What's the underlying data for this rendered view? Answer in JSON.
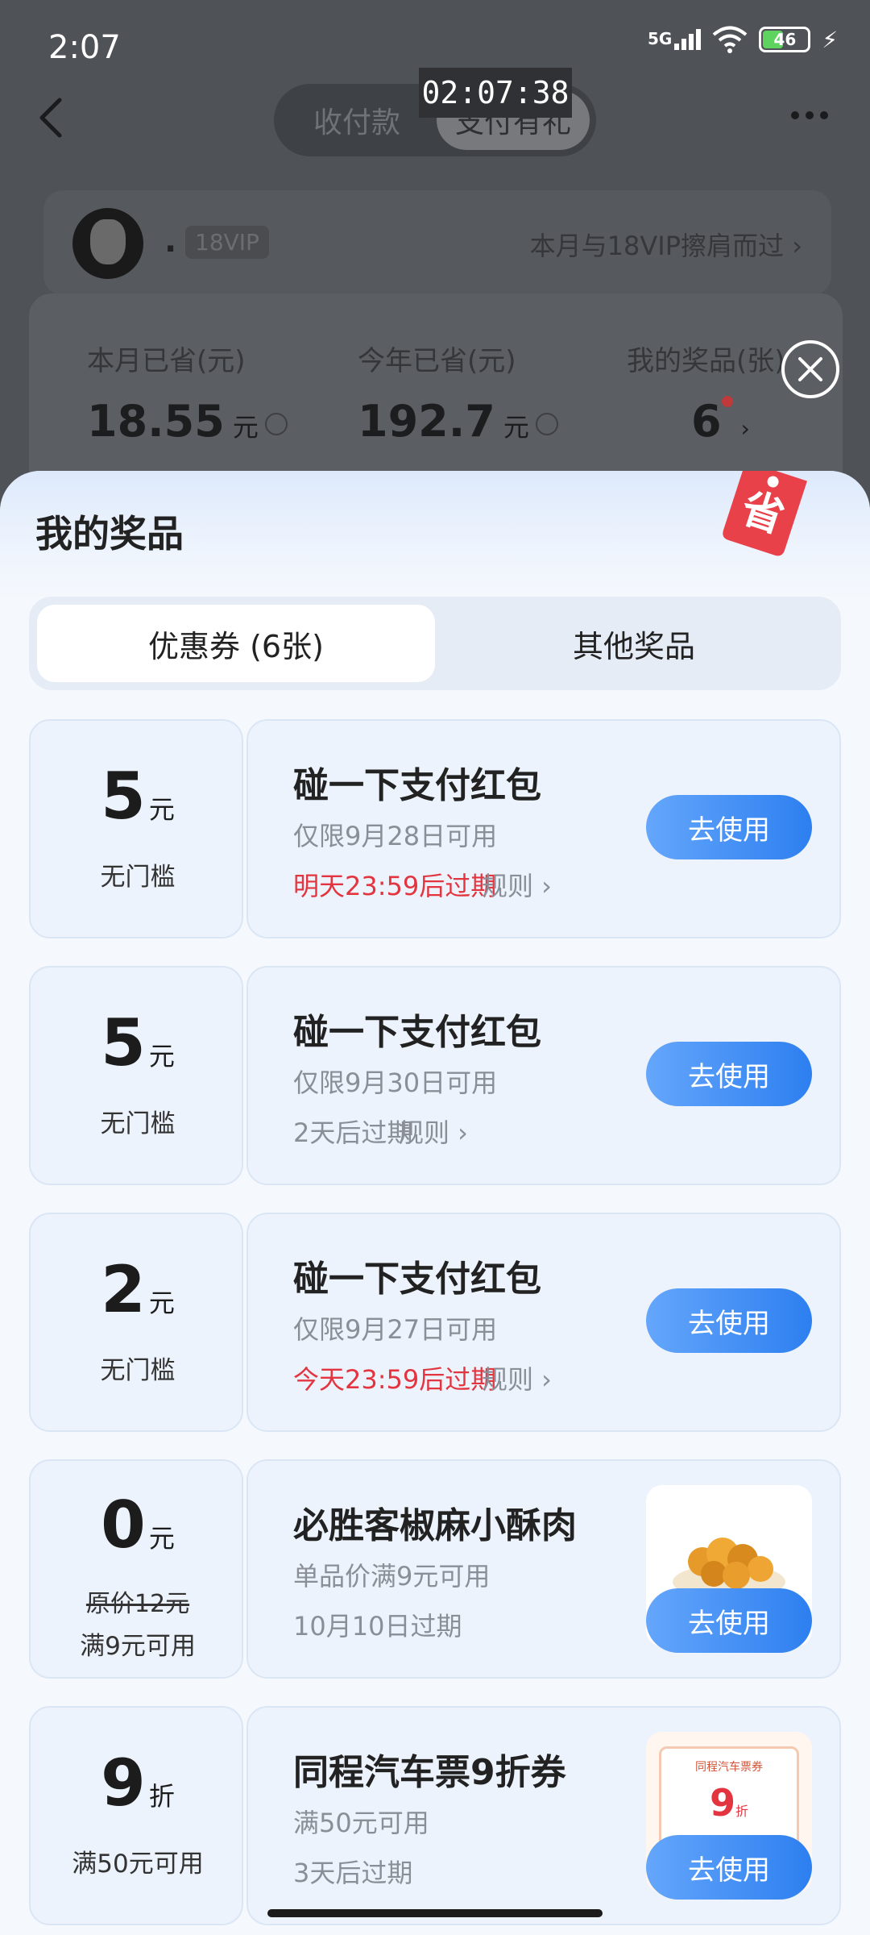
{
  "status_bar": {
    "time": "2:07",
    "network": "5G",
    "battery": "46"
  },
  "header": {
    "tab_inactive": "收付款",
    "tab_active": "支付有礼",
    "time_overlay": "02:07:38"
  },
  "member": {
    "name": ".",
    "vip_badge": "18VIP",
    "link": "本月与18VIP擦肩而过 ›"
  },
  "stats": {
    "month_label": "本月已省(元)",
    "month_value": "18.55",
    "year_label": "今年已省(元)",
    "year_value": "192.7",
    "unit": "元",
    "prizes_label": "我的奖品(张)",
    "prizes_value": "6"
  },
  "sheet": {
    "title": "我的奖品",
    "tag_char": "省",
    "tabs": [
      "优惠券 (6张)",
      "其他奖品"
    ]
  },
  "coupons": [
    {
      "amount": "5",
      "unit": "元",
      "condition": "无门槛",
      "title": "碰一下支付红包",
      "valid": "仅限9月28日可用",
      "expire": "明天23:59后过期",
      "urgent": true,
      "rules": "规则 ›",
      "button": "去使用"
    },
    {
      "amount": "5",
      "unit": "元",
      "condition": "无门槛",
      "title": "碰一下支付红包",
      "valid": "仅限9月30日可用",
      "expire": "2天后过期",
      "urgent": false,
      "rules": "规则 ›",
      "button": "去使用"
    },
    {
      "amount": "2",
      "unit": "元",
      "condition": "无门槛",
      "title": "碰一下支付红包",
      "valid": "仅限9月27日可用",
      "expire": "今天23:59后过期",
      "urgent": true,
      "rules": "规则 ›",
      "button": "去使用"
    },
    {
      "amount": "0",
      "unit": "元",
      "original": "原价12元",
      "condition": "满9元可用",
      "title": "必胜客椒麻小酥肉",
      "valid": "单品价满9元可用",
      "expire": "10月10日过期",
      "button": "去使用",
      "thumb": "fried-chicken-image"
    },
    {
      "amount": "9",
      "unit": "折",
      "condition": "满50元可用",
      "title": "同程汽车票9折券",
      "valid": "满50元可用",
      "expire": "3天后过期",
      "button": "去使用",
      "thumb": "bus-ticket-image",
      "thumb_caption": "同程汽车票券",
      "thumb_value": "9",
      "thumb_unit": "折"
    }
  ],
  "colors": {
    "accent": "#2d7ff0",
    "urgent": "#e2353f",
    "tag_red": "#e8414a"
  }
}
